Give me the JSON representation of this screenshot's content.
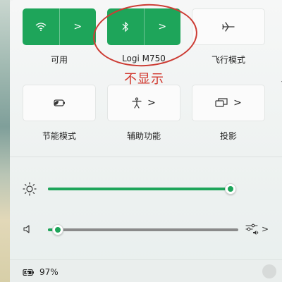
{
  "tiles": [
    {
      "label": "可用",
      "icon": "wifi-icon",
      "state": "on",
      "has_chevron": true
    },
    {
      "label": "Logi M750",
      "icon": "bluetooth-icon",
      "state": "on",
      "has_chevron": true
    },
    {
      "label": "飞行模式",
      "icon": "airplane-icon",
      "state": "off",
      "has_chevron": false
    },
    {
      "label": "节能模式",
      "icon": "battery-saver-icon",
      "state": "off",
      "has_chevron": false
    },
    {
      "label": "辅助功能",
      "icon": "accessibility-icon",
      "state": "off",
      "has_chevron": true
    },
    {
      "label": "投影",
      "icon": "project-icon",
      "state": "off",
      "has_chevron": true
    }
  ],
  "chevron_glyph": ">",
  "annotation": {
    "text": "不显示",
    "color": "#d1352b"
  },
  "brightness": {
    "icon": "brightness-icon",
    "level": 0.99
  },
  "volume": {
    "icon": "speaker-icon",
    "level": 0.05,
    "mixer_icon": "audio-mixer-icon",
    "mixer_glyph": ">"
  },
  "battery": {
    "icon": "battery-charging-icon",
    "percent_text": "97%"
  },
  "colors": {
    "accent": "#1ea55a",
    "annotation": "#cc3b33"
  }
}
